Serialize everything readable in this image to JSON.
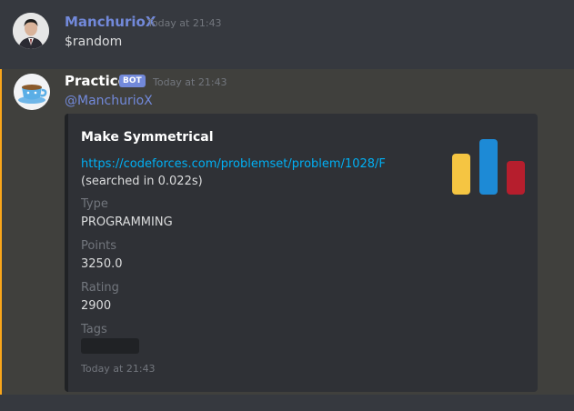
{
  "messages": [
    {
      "author": "ManchurioX",
      "timestamp": "Today at 21:43",
      "content": "$random"
    },
    {
      "author": "Practice",
      "badge": "BOT",
      "timestamp": "Today at 21:43",
      "mention": "@ManchurioX",
      "embed": {
        "title": "Make Symmetrical",
        "link": "https://codeforces.com/problemset/problem/1028/F",
        "link_suffix": " (searched in 0.022s)",
        "fields": [
          {
            "name": "Type",
            "value": "PROGRAMMING"
          },
          {
            "name": "Points",
            "value": "3250.0"
          },
          {
            "name": "Rating",
            "value": "2900"
          },
          {
            "name": "Tags",
            "value": ""
          }
        ],
        "footer": "Today at 21:43",
        "thumbnail_icon": "codeforces-logo-icon"
      }
    }
  ],
  "colors": {
    "background": "#36393f",
    "highlight_row": "#40403d",
    "mention_bar": "#faa61a",
    "embed_bg": "#2f3136",
    "link": "#00b0f4",
    "username_user": "#7289da",
    "bot_badge": "#7289da",
    "logo_yellow": "#f5c542",
    "logo_blue": "#1d8ad6",
    "logo_red": "#b61e2d"
  }
}
